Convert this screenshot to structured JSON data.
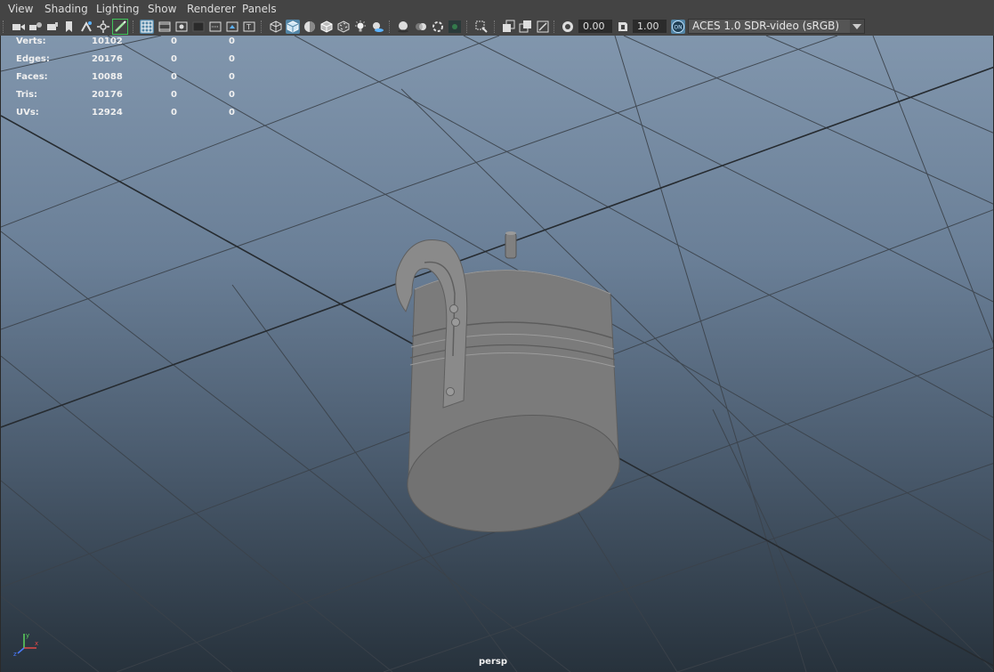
{
  "menu": [
    "View",
    "Shading",
    "Lighting",
    "Show",
    "Renderer",
    "Panels"
  ],
  "toolbar": {
    "icons": [
      "select-camera-icon",
      "camera-attributes-icon",
      "bookmarks-icon",
      "image-plane-icon",
      "2d-pan-zoom-icon",
      "grease-pencil-icon",
      "grid-icon",
      "film-gate-icon",
      "resolution-gate-icon",
      "gate-mask-icon",
      "field-chart-icon",
      "safe-action-icon",
      "safe-title-icon",
      "wireframe-icon",
      "smooth-shade-icon",
      "default-material-icon",
      "wireframe-on-shaded-icon",
      "textured-icon",
      "use-all-lights-icon",
      "shadows-icon",
      "screen-space-ao-icon",
      "motion-blur-icon",
      "multisample-aa-icon",
      "depth-of-field-icon",
      "isolate-select-icon",
      "xray-icon",
      "xray-active-icon",
      "xray-joints-icon",
      "exposure-icon",
      "gamma-icon",
      "color-management-icon"
    ],
    "exposure_value": "0.00",
    "gamma_value": "1.00",
    "color_management_badge": "ON",
    "view_transform": "ACES 1.0 SDR-video (sRGB)"
  },
  "hud": {
    "rows": [
      {
        "label": "Verts:",
        "total": "10102",
        "selected": "0",
        "sel_comp": "0"
      },
      {
        "label": "Edges:",
        "total": "20176",
        "selected": "0",
        "sel_comp": "0"
      },
      {
        "label": "Faces:",
        "total": "10088",
        "selected": "0",
        "sel_comp": "0"
      },
      {
        "label": "Tris:",
        "total": "20176",
        "selected": "0",
        "sel_comp": "0"
      },
      {
        "label": "UVs:",
        "total": "12924",
        "selected": "0",
        "sel_comp": "0"
      }
    ]
  },
  "camera_label": "persp",
  "axis": {
    "x": "x",
    "y": "y",
    "z": "z",
    "x_color": "#e04848",
    "y_color": "#5cd65c",
    "z_color": "#4a7bff"
  },
  "colors": {
    "accent": "#5285a6",
    "menubar": "#444444",
    "grid_line": "#3a3f45",
    "mesh": "#7a7a7a"
  }
}
